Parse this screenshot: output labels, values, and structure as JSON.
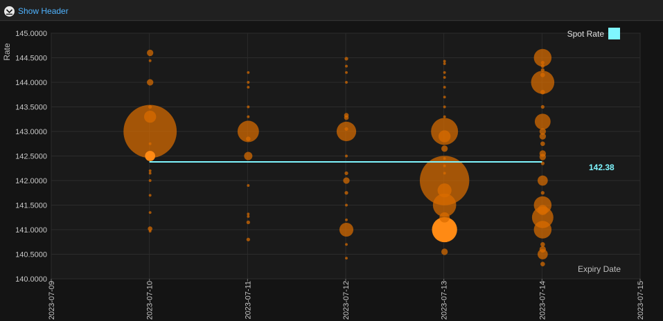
{
  "header": {
    "toggle_label": "Show Header",
    "toggle_icon": "collapse-down-icon"
  },
  "colors": {
    "bubble": "#d96c00",
    "bubble_highlight": "#ff8a14",
    "spot_line": "#7ff6ff",
    "background": "#141414",
    "grid": "#2c2c2c"
  },
  "chart_data": {
    "type": "scatter",
    "ylabel": "Rate",
    "xlabel": "Expiry Date",
    "ylim": [
      140.0,
      145.0
    ],
    "y_ticks": [
      "145.0000",
      "144.5000",
      "144.0000",
      "143.5000",
      "143.0000",
      "142.5000",
      "142.0000",
      "141.5000",
      "141.0000",
      "140.5000",
      "140.0000"
    ],
    "x_ticks": [
      "2023-07-09",
      "2023-07-10",
      "2023-07-11",
      "2023-07-12",
      "2023-07-13",
      "2023-07-14",
      "2023-07-15"
    ],
    "legend": [
      {
        "name": "Spot Rate",
        "color": "#7ff6ff"
      }
    ],
    "spot_rate": {
      "value": 142.38,
      "label": "142.38",
      "x_start": "2023-07-10",
      "x_end": "2023-07-14"
    },
    "grid": true,
    "bubble_series": [
      {
        "x": "2023-07-10",
        "points": [
          {
            "y": 144.6,
            "size": 3
          },
          {
            "y": 144.44,
            "size": 1
          },
          {
            "y": 144.0,
            "size": 3
          },
          {
            "y": 143.5,
            "size": 1.5
          },
          {
            "y": 143.3,
            "size": 6
          },
          {
            "y": 143.0,
            "size": 28
          },
          {
            "y": 142.75,
            "size": 1
          },
          {
            "y": 142.5,
            "size": 5,
            "highlight": true
          },
          {
            "y": 142.2,
            "size": 1
          },
          {
            "y": 142.15,
            "size": 1
          },
          {
            "y": 142.0,
            "size": 1
          },
          {
            "y": 141.7,
            "size": 1
          },
          {
            "y": 141.35,
            "size": 1
          },
          {
            "y": 141.02,
            "size": 2
          },
          {
            "y": 140.97,
            "size": 1
          }
        ]
      },
      {
        "x": "2023-07-11",
        "points": [
          {
            "y": 144.2,
            "size": 1
          },
          {
            "y": 144.0,
            "size": 1
          },
          {
            "y": 143.9,
            "size": 1
          },
          {
            "y": 143.5,
            "size": 1
          },
          {
            "y": 143.3,
            "size": 1
          },
          {
            "y": 143.0,
            "size": 11
          },
          {
            "y": 142.85,
            "size": 2
          },
          {
            "y": 142.5,
            "size": 4
          },
          {
            "y": 141.9,
            "size": 1
          },
          {
            "y": 141.32,
            "size": 1
          },
          {
            "y": 141.27,
            "size": 1
          },
          {
            "y": 141.15,
            "size": 1.5
          },
          {
            "y": 140.8,
            "size": 1.5
          }
        ]
      },
      {
        "x": "2023-07-12",
        "points": [
          {
            "y": 144.48,
            "size": 1.5
          },
          {
            "y": 144.33,
            "size": 1
          },
          {
            "y": 144.2,
            "size": 1
          },
          {
            "y": 144.0,
            "size": 1
          },
          {
            "y": 143.33,
            "size": 2
          },
          {
            "y": 143.28,
            "size": 2
          },
          {
            "y": 143.05,
            "size": 1.5
          },
          {
            "y": 143.0,
            "size": 10
          },
          {
            "y": 142.5,
            "size": 1
          },
          {
            "y": 142.15,
            "size": 1.5
          },
          {
            "y": 142.0,
            "size": 3
          },
          {
            "y": 141.75,
            "size": 1.5
          },
          {
            "y": 141.5,
            "size": 1
          },
          {
            "y": 141.0,
            "size": 7
          },
          {
            "y": 141.2,
            "size": 1
          },
          {
            "y": 140.7,
            "size": 1
          },
          {
            "y": 140.42,
            "size": 1
          }
        ]
      },
      {
        "x": "2023-07-13",
        "points": [
          {
            "y": 144.43,
            "size": 1
          },
          {
            "y": 144.38,
            "size": 1
          },
          {
            "y": 144.2,
            "size": 1
          },
          {
            "y": 144.1,
            "size": 1
          },
          {
            "y": 143.9,
            "size": 1
          },
          {
            "y": 143.7,
            "size": 1
          },
          {
            "y": 143.5,
            "size": 1
          },
          {
            "y": 143.3,
            "size": 1
          },
          {
            "y": 143.0,
            "size": 14
          },
          {
            "y": 142.9,
            "size": 6
          },
          {
            "y": 142.65,
            "size": 3
          },
          {
            "y": 142.45,
            "size": 1
          },
          {
            "y": 142.3,
            "size": 1
          },
          {
            "y": 142.15,
            "size": 1
          },
          {
            "y": 142.0,
            "size": 26
          },
          {
            "y": 141.8,
            "size": 7
          },
          {
            "y": 141.5,
            "size": 12
          },
          {
            "y": 141.25,
            "size": 5
          },
          {
            "y": 141.0,
            "size": 13,
            "highlight": true
          },
          {
            "y": 140.55,
            "size": 3
          }
        ]
      },
      {
        "x": "2023-07-14",
        "points": [
          {
            "y": 144.5,
            "size": 9
          },
          {
            "y": 144.4,
            "size": 1.5
          },
          {
            "y": 144.33,
            "size": 1.5
          },
          {
            "y": 144.25,
            "size": 1.5
          },
          {
            "y": 144.15,
            "size": 2
          },
          {
            "y": 144.0,
            "size": 12
          },
          {
            "y": 143.8,
            "size": 2
          },
          {
            "y": 143.5,
            "size": 1.5
          },
          {
            "y": 143.2,
            "size": 8
          },
          {
            "y": 143.0,
            "size": 3
          },
          {
            "y": 142.9,
            "size": 3
          },
          {
            "y": 142.75,
            "size": 2
          },
          {
            "y": 142.55,
            "size": 3
          },
          {
            "y": 142.48,
            "size": 3
          },
          {
            "y": 142.35,
            "size": 1.5
          },
          {
            "y": 142.0,
            "size": 5
          },
          {
            "y": 141.75,
            "size": 1.5
          },
          {
            "y": 141.5,
            "size": 9
          },
          {
            "y": 141.4,
            "size": 5
          },
          {
            "y": 141.25,
            "size": 11
          },
          {
            "y": 141.0,
            "size": 9
          },
          {
            "y": 140.7,
            "size": 2
          },
          {
            "y": 140.6,
            "size": 3
          },
          {
            "y": 140.5,
            "size": 5
          },
          {
            "y": 140.3,
            "size": 2
          }
        ]
      }
    ]
  }
}
